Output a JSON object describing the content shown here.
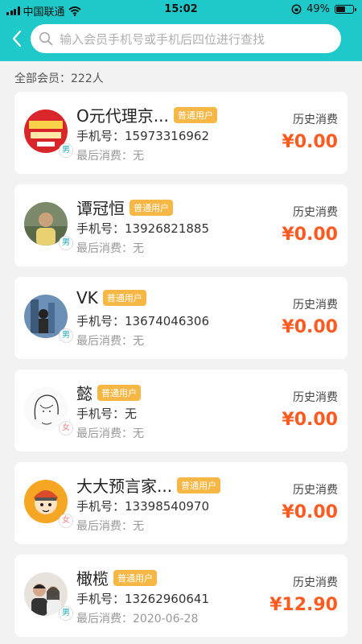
{
  "status_bar": {
    "carrier": "中国联通",
    "time": "15:02",
    "battery": "49%"
  },
  "search": {
    "placeholder": "输入会员手机号或手机后四位进行查找"
  },
  "summary": {
    "total_members": "全部会员：222人"
  },
  "labels": {
    "phone_prefix": "手机号：",
    "last_prefix": "最后消费：",
    "history": "历史消费"
  },
  "members": [
    {
      "name": "O元代理京...",
      "badge": "普通用户",
      "gender": "男",
      "phone": "15973316962",
      "last": "无",
      "history": "¥0.00",
      "avatar": "avatar-red-poster"
    },
    {
      "name": "谭冠恒",
      "badge": "普通用户",
      "gender": "男",
      "phone": "13926821885",
      "last": "无",
      "history": "¥0.00",
      "avatar": "avatar-photo-man"
    },
    {
      "name": "VK",
      "badge": "普通用户",
      "gender": "男",
      "phone": "13674046306",
      "last": "无",
      "history": "¥0.00",
      "avatar": "avatar-photo-blue"
    },
    {
      "name": "懿",
      "badge": "普通用户",
      "gender": "女",
      "phone": "无",
      "last": "无",
      "history": "¥0.00",
      "avatar": "avatar-sketch-girl"
    },
    {
      "name": "大大预言家...",
      "badge": "普通用户",
      "gender": "女",
      "phone": "13398540970",
      "last": "无",
      "history": "¥0.00",
      "avatar": "avatar-cartoon-ninja"
    },
    {
      "name": "橄榄",
      "badge": "普通用户",
      "gender": "男",
      "phone": "13262960641",
      "last": "2020-06-28",
      "history": "¥12.90",
      "avatar": "avatar-photo-couple"
    }
  ]
}
